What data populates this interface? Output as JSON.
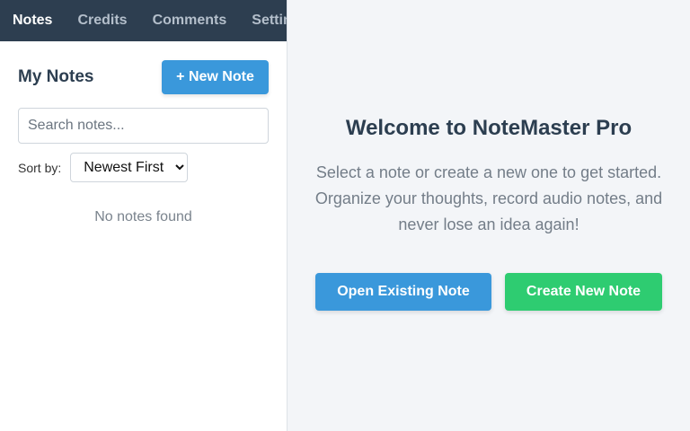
{
  "nav": {
    "tabs": [
      {
        "label": "Notes",
        "active": true
      },
      {
        "label": "Credits",
        "active": false
      },
      {
        "label": "Comments",
        "active": false
      },
      {
        "label": "Settings",
        "active": false
      }
    ]
  },
  "sidebar": {
    "title": "My Notes",
    "new_note_label": "+ New Note",
    "search": {
      "placeholder": "Search notes...",
      "value": ""
    },
    "sort": {
      "label": "Sort by:",
      "selected": "Newest First"
    },
    "empty_message": "No notes found"
  },
  "main": {
    "title": "Welcome to NoteMaster Pro",
    "description": "Select a note or create a new one to get started. Organize your thoughts, record audio notes, and never lose an idea again!",
    "open_label": "Open Existing Note",
    "create_label": "Create New Note"
  },
  "colors": {
    "nav_bg": "#2d3e50",
    "primary": "#3a98db",
    "success": "#2ecc71",
    "heading": "#2c3e50"
  }
}
